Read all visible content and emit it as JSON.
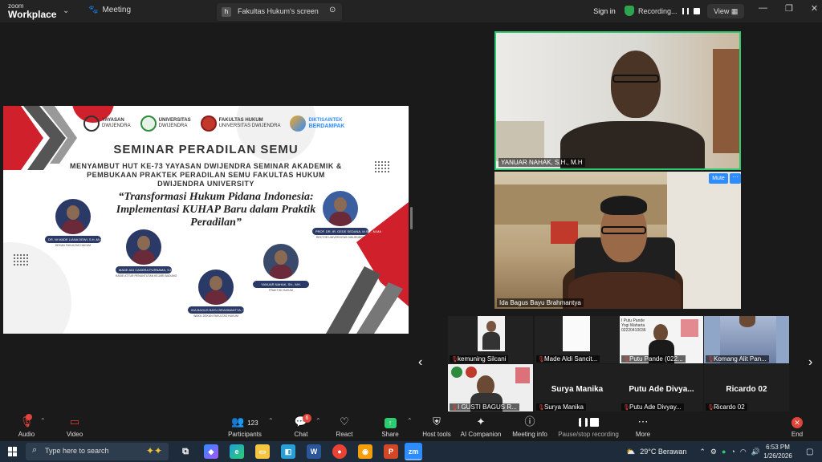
{
  "app": {
    "brand_small": "zoom",
    "brand_big": "Workplace",
    "meeting_label": "Meeting"
  },
  "share_tab": {
    "label": "Fakultas Hukum's screen",
    "h_badge": "h"
  },
  "topbar": {
    "sign_in": "Sign in",
    "recording": "Recording...",
    "view": "View"
  },
  "slide": {
    "logos": [
      {
        "top": "YAYASAN",
        "bottom": "DWIJENDRA"
      },
      {
        "top": "UNIVERSITAS",
        "bottom": "DWIJENDRA"
      },
      {
        "top": "FAKULTAS HUKUM",
        "bottom": "UNIVERSITAS DWIJENDRA"
      },
      {
        "top": "DIKTISAINTEK",
        "bottom": "BERDAMPAK"
      }
    ],
    "title": "SEMINAR PERADILAN SEMU",
    "subtitle": "MENYAMBUT HUT KE-73 YAYASAN DWIJENDRA SEMINAR AKADEMIK & PEMBUKAAN PRAKTEK PERADILAN SEMU FAKULTAS HUKUM DWIJENDRA UNIVERSITY",
    "theme": "“Transformasi Hukum Pidana Indonesia: Implementasi KUHAP Baru dalam Praktik Peradilan”",
    "speakers": [
      {
        "name": "DR. NI MADE LIANA DEWI, S.H.,M.H",
        "role": "DEKAN FAKULTAS HUKUM"
      },
      {
        "name": "PROF. DR. IR. GEDE SEDANA, M.SC., M.MA",
        "role": "REKTOR UNIVERSITAS DWIJENDRA"
      },
      {
        "name": "MADE ADI CANDRA PURNAMA, S.H.",
        "role": "KASIE ATTUR PENUNTUTAN KEJARI BADUNG"
      },
      {
        "name": "YANUAR NAHAK, SH., MH.",
        "role": "PRAKTISI HUKUM"
      },
      {
        "name": "IDA BAGUS BAYU BRAHMANTYA, S.H.,M.H",
        "role": "WAKIL DEKAN FAKULTAS HUKUM"
      }
    ]
  },
  "tiles": [
    {
      "name": "YANUAR NAHAK, S.H., M.H"
    },
    {
      "name": "Ida Bagus Bayu Brahmantya"
    }
  ],
  "tile_controls": {
    "mute": "Mute",
    "more": "···"
  },
  "thumbs": [
    {
      "name": "kemuning Silcani"
    },
    {
      "name": "Made Aldi Sancit..."
    },
    {
      "name": "Putu Pande (022..."
    },
    {
      "name": "Komang Alit Pan..."
    },
    {
      "name": "I GUSTI BAGUS R..."
    },
    {
      "name": "Surya Manika",
      "big": "Surya Manika"
    },
    {
      "name": "Putu Ade Divyay...",
      "big": "Putu Ade Divya..."
    },
    {
      "name": "Ricardo 02",
      "big": "Ricardo 02"
    }
  ],
  "thumb_overlay_text": "I Putu Pande Yogi Maharta 02220410036",
  "toolbar": {
    "audio": "Audio",
    "video": "Video",
    "participants": "Participants",
    "participants_count": "123",
    "chat": "Chat",
    "chat_badge": "6",
    "react": "React",
    "share": "Share",
    "host_tools": "Host tools",
    "ai_companion": "AI Companion",
    "meeting_info": "Meeting info",
    "pause_stop": "Pause/stop recording",
    "more": "More",
    "end": "End"
  },
  "taskbar": {
    "search_placeholder": "Type here to search",
    "weather": "29°C  Berawan",
    "time": "6:53 PM",
    "date": "1/26/2026"
  },
  "colors": {
    "accent": "#2d8cff",
    "active_border": "#2ecc71",
    "danger": "#e0443b",
    "slide_navy": "#2a3966",
    "slide_red": "#d0202b"
  }
}
